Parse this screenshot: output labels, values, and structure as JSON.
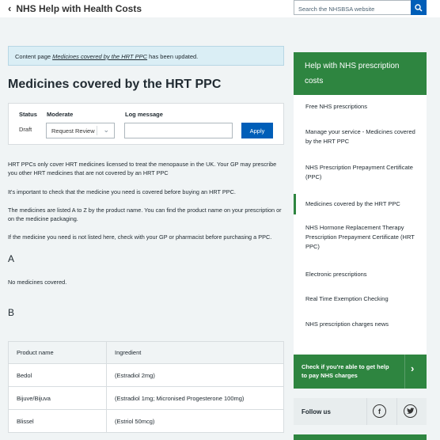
{
  "header": {
    "back_label": "NHS Help with Health Costs",
    "search_placeholder": "Search the NHSBSA website"
  },
  "notice": {
    "prefix": "Content page ",
    "link": "Medicines covered by the HRT PPC",
    "suffix": " has been updated."
  },
  "page_title": "Medicines covered by the HRT PPC",
  "workflow": {
    "status_label": "Status",
    "status_value": "Draft",
    "moderate_label": "Moderate",
    "moderate_value": "Request Review",
    "log_label": "Log message",
    "log_value": "",
    "apply_label": "Apply"
  },
  "body": {
    "p1": "HRT PPCs only cover HRT medicines licensed to treat the menopause in the UK. Your GP may prescribe you other HRT medicines that are not covered by an HRT PPC",
    "p2": "It's important to check that the medicine you need is covered before buying an HRT PPC.",
    "p3": "The medicines are listed A to Z by the product name. You can find the product name on your prescription or on the medicine packaging.",
    "p4": "If the medicine you need is not listed here, check with your GP or pharmacist before purchasing a PPC.",
    "section_a": "A",
    "section_a_text": "No medicines covered.",
    "section_b": "B"
  },
  "table": {
    "headers": [
      "Product name",
      "Ingredient"
    ],
    "rows": [
      [
        "Bedol",
        "(Estradiol 2mg)"
      ],
      [
        "Bijuve/Bijuva",
        "(Estradiol 1mg; Micronised Progesterone 100mg)"
      ],
      [
        "Blissel",
        "(Estriol 50mcg)"
      ]
    ]
  },
  "sidebar": {
    "heading": "Help with NHS prescription costs",
    "items": [
      "Free NHS prescriptions",
      "Manage your service - Medicines covered by the HRT PPC",
      "NHS Prescription Prepayment Certificate (PPC)",
      "Medicines covered by the HRT PPC",
      "NHS Hormone Replacement Therapy Prescription Prepayment Certificate (HRT PPC)",
      "Electronic prescriptions",
      "Real Time Exemption Checking",
      "NHS prescription charges news"
    ],
    "active_index": 3
  },
  "cta": {
    "label": "Check if you're able to get help to pay NHS charges"
  },
  "follow": {
    "label": "Follow us"
  },
  "icons": [
    "chevron-left-icon",
    "search-icon",
    "chevron-down-icon",
    "chevron-right-icon",
    "facebook-icon",
    "twitter-icon"
  ],
  "colors": {
    "accent": "#005eb8",
    "green": "#2e8540",
    "background": "#f0f4f5",
    "notice": "#daeef5"
  }
}
